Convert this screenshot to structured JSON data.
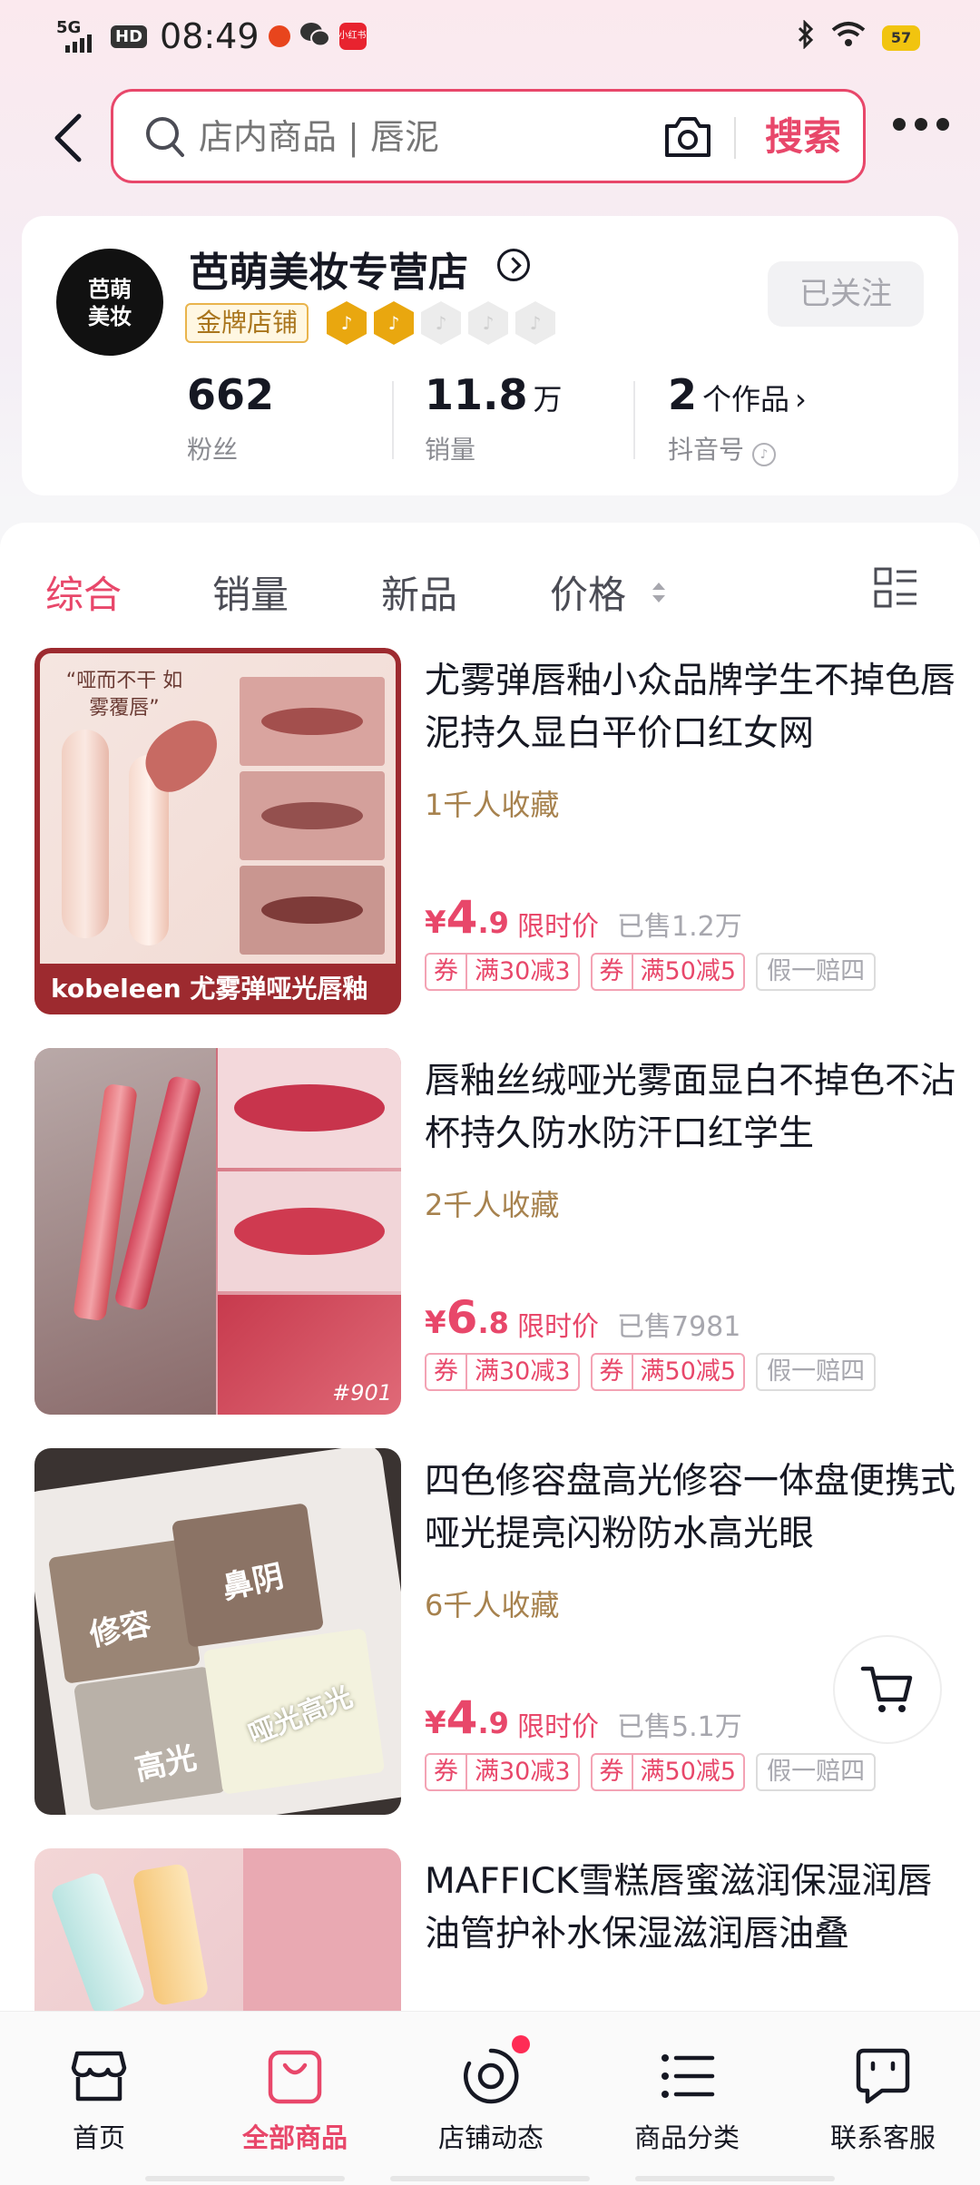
{
  "status_bar": {
    "network": "5G",
    "hd": "HD",
    "time": "08:49",
    "battery": "57"
  },
  "search": {
    "placeholder": "店内商品 | 唇泥",
    "button_label": "搜索"
  },
  "shop": {
    "logo_line1": "芭萌",
    "logo_line2": "美妆",
    "name": "芭萌美妆专营店",
    "badge": "金牌店铺",
    "follow_label": "已关注",
    "stats": [
      {
        "value": "662",
        "unit": "",
        "label": "粉丝"
      },
      {
        "value": "11.8",
        "unit": "万",
        "label": "销量"
      },
      {
        "value": "2",
        "unit": "个作品",
        "label": "抖音号"
      }
    ]
  },
  "sort_tabs": [
    "综合",
    "销量",
    "新品",
    "价格"
  ],
  "products": [
    {
      "title": "尤雾弹唇釉小众品牌学生不掉色唇泥持久显白平价口红女网",
      "favorites": "1千人收藏",
      "price_currency": "¥",
      "price_int": "4",
      "price_dec": ".9",
      "limited": "限时价",
      "sold": "已售1.2万",
      "coupons": [
        {
          "k": "券",
          "v": "满30减3"
        },
        {
          "k": "券",
          "v": "满50减5"
        }
      ],
      "guarantee": "假一赔四",
      "img_caption": "kobeleen 尤雾弹哑光唇釉",
      "img_quote": "“哑而不干 如雾覆唇”"
    },
    {
      "title": "唇釉丝绒哑光雾面显白不掉色不沾杯持久防水防汗口红学生",
      "favorites": "2千人收藏",
      "price_currency": "¥",
      "price_int": "6",
      "price_dec": ".8",
      "limited": "限时价",
      "sold": "已售7981",
      "coupons": [
        {
          "k": "券",
          "v": "满30减3"
        },
        {
          "k": "券",
          "v": "满50减5"
        }
      ],
      "guarantee": "假一赔四",
      "img_caption": "#901"
    },
    {
      "title": "四色修容盘高光修容一体盘便携式哑光提亮闪粉防水高光眼",
      "favorites": "6千人收藏",
      "price_currency": "¥",
      "price_int": "4",
      "price_dec": ".9",
      "limited": "限时价",
      "sold": "已售5.1万",
      "coupons": [
        {
          "k": "券",
          "v": "满30减3"
        },
        {
          "k": "券",
          "v": "满50减5"
        }
      ],
      "guarantee": "假一赔四",
      "img_labels": [
        "修容",
        "鼻阴",
        "高光",
        "哑光高光"
      ]
    },
    {
      "title": "MAFFICK雪糕唇蜜滋润保湿润唇油管护补水保湿滋润唇油叠",
      "favorites": "",
      "price_currency": "",
      "price_int": "",
      "price_dec": "",
      "limited": "",
      "sold": ""
    }
  ],
  "bottom_nav": [
    {
      "label": "首页",
      "icon": "shop-icon"
    },
    {
      "label": "全部商品",
      "icon": "bag-icon"
    },
    {
      "label": "店铺动态",
      "icon": "camera-ring-icon"
    },
    {
      "label": "商品分类",
      "icon": "list-icon"
    },
    {
      "label": "联系客服",
      "icon": "chat-icon"
    }
  ],
  "colors": {
    "accent": "#e8476a",
    "gold": "#e9b44c",
    "fav_text": "#a7824e"
  }
}
